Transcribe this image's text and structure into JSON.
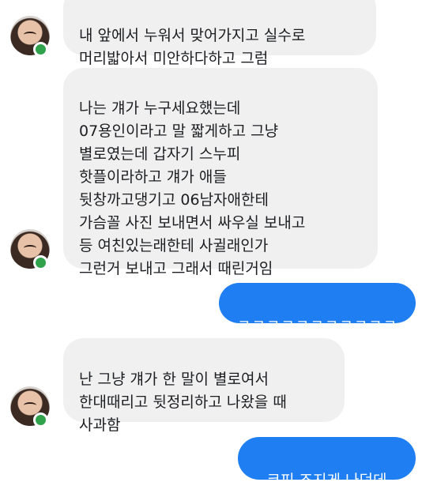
{
  "messages": [
    {
      "sender": "other",
      "text": "내 앞에서 누워서 맞어가지고 실수로\n머리밟아서 미안하다하고 그럼"
    },
    {
      "sender": "other",
      "text": "나는 걔가 누구세요했는데\n07용인이라고 말 짧게하고 그냥\n별로였는데 갑자기 스누피\n핫플이라하고 걔가 애들\n뒷창까고댕기고 06남자애한테\n가슴꼴 사진 보내면서 싸우실 보내고\n등 여친있는래한테 사귈래인가\n그런거 보내고 그래서 때린거임"
    },
    {
      "sender": "me",
      "text": "ㅋㅋㅋㅋㅋㅋㅋㅋㅋㅋㅋ"
    },
    {
      "sender": "other",
      "text": "난 그냥 걔가 한 말이 별로여서\n한대때리고 뒷정리하고 나왔을 때\n사과함"
    },
    {
      "sender": "me",
      "text": "코피 조지게 나던데"
    }
  ],
  "colors": {
    "sent_bubble": "#1e7ef2",
    "received_bubble": "#f0f0f0",
    "online_status": "#31a24c"
  },
  "icons": {
    "avatar": "profile-photo",
    "status": "online-dot"
  }
}
